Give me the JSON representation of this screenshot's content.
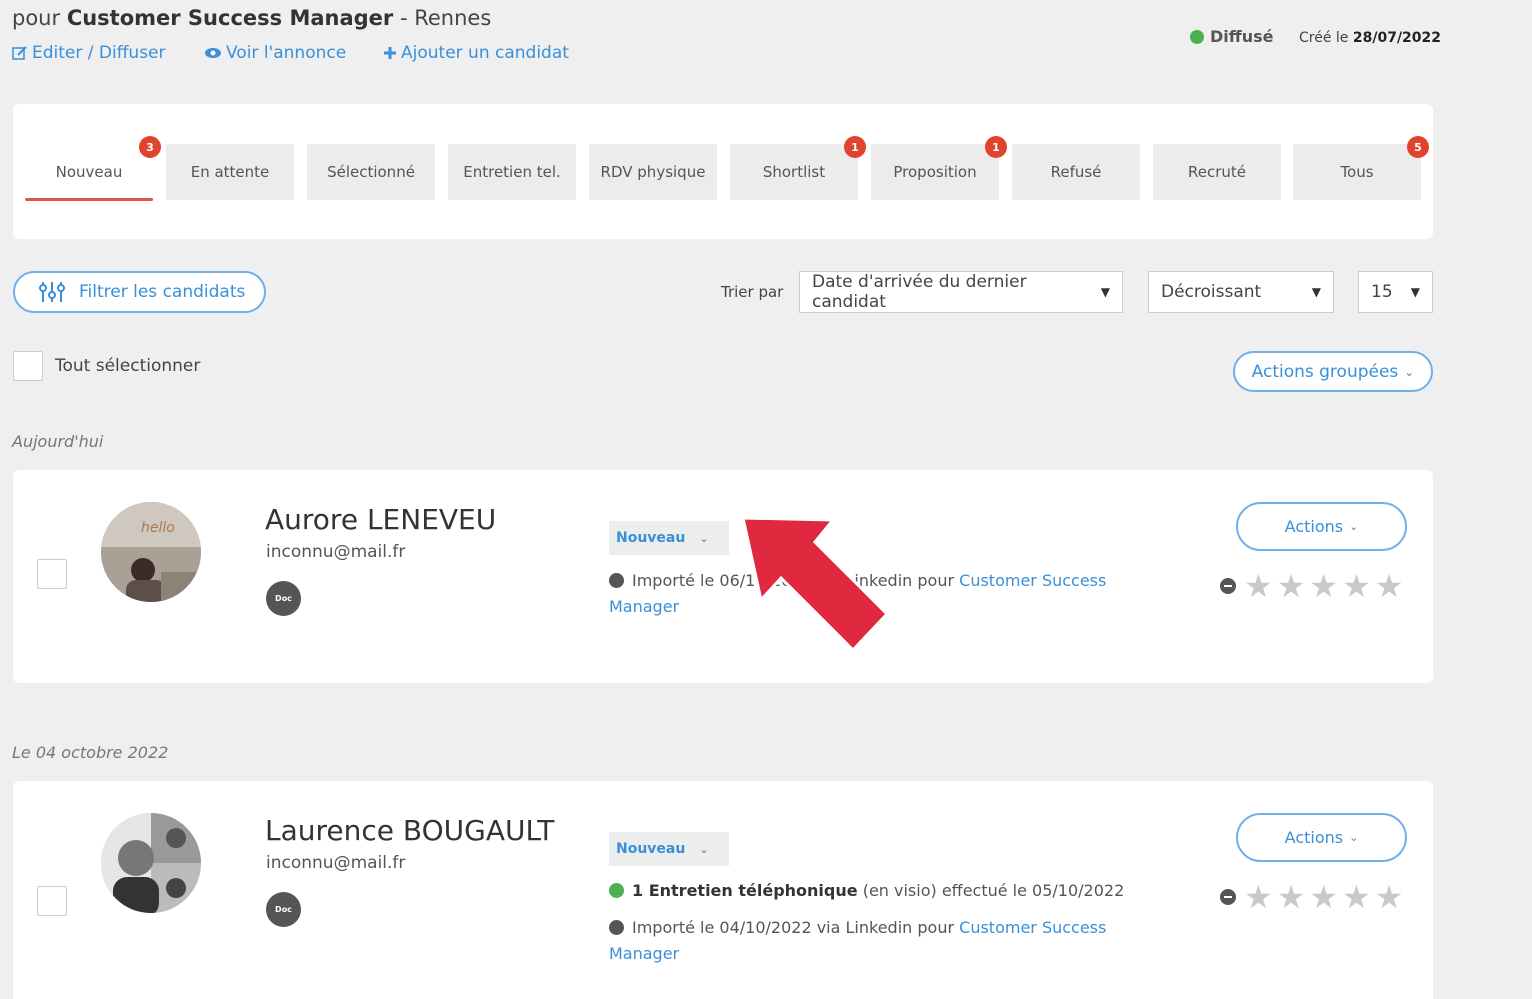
{
  "header": {
    "title_prefix": "pour",
    "job_title": "Customer Success Manager",
    "location": "- Rennes",
    "links": {
      "edit": "Editer / Diffuser",
      "view": "Voir l'annonce",
      "add": "Ajouter un candidat"
    },
    "status": {
      "label": "Diffusé",
      "color": "#4caf50"
    },
    "created_label": "Créé le",
    "created_date": "28/07/2022"
  },
  "tabs": [
    {
      "label": "Nouveau",
      "badge": "3",
      "active": true
    },
    {
      "label": "En attente",
      "badge": ""
    },
    {
      "label": "Sélectionné",
      "badge": ""
    },
    {
      "label": "Entretien tel.",
      "badge": ""
    },
    {
      "label": "RDV physique",
      "badge": ""
    },
    {
      "label": "Shortlist",
      "badge": "1"
    },
    {
      "label": "Proposition",
      "badge": "1"
    },
    {
      "label": "Refusé",
      "badge": ""
    },
    {
      "label": "Recruté",
      "badge": ""
    },
    {
      "label": "Tous",
      "badge": "5"
    }
  ],
  "toolbar": {
    "filter_label": "Filtrer les candidats",
    "sort_label": "Trier par",
    "sort_value": "Date d'arrivée du dernier candidat",
    "order_value": "Décroissant",
    "per_page_value": "15",
    "select_all_label": "Tout sélectionner",
    "grouped_actions_label": "Actions groupées"
  },
  "sections": [
    {
      "label": "Aujourd'hui",
      "candidate": {
        "name": "Aurore LENEVEU",
        "email": "inconnu@mail.fr",
        "doc_label": "Doc",
        "status": "Nouveau",
        "import_text": "Importé le 06/10/2022 via Linkedin pour",
        "import_link": "Customer Success Manager",
        "actions_label": "Actions",
        "rating": 0
      }
    },
    {
      "label": "Le 04 octobre 2022",
      "candidate": {
        "name": "Laurence BOUGAULT",
        "email": "inconnu@mail.fr",
        "doc_label": "Doc",
        "status": "Nouveau",
        "interview_bold": "1 Entretien téléphonique",
        "interview_rest": "(en visio) effectué le 05/10/2022",
        "import_text": "Importé le 04/10/2022 via Linkedin pour",
        "import_link": "Customer Success Manager",
        "actions_label": "Actions",
        "rating": 0
      }
    }
  ],
  "colors": {
    "accent": "#3a8fd9",
    "badge": "#e0442f",
    "arrow": "#e0283f",
    "done": "#4caf50",
    "neutral": "#555555"
  }
}
